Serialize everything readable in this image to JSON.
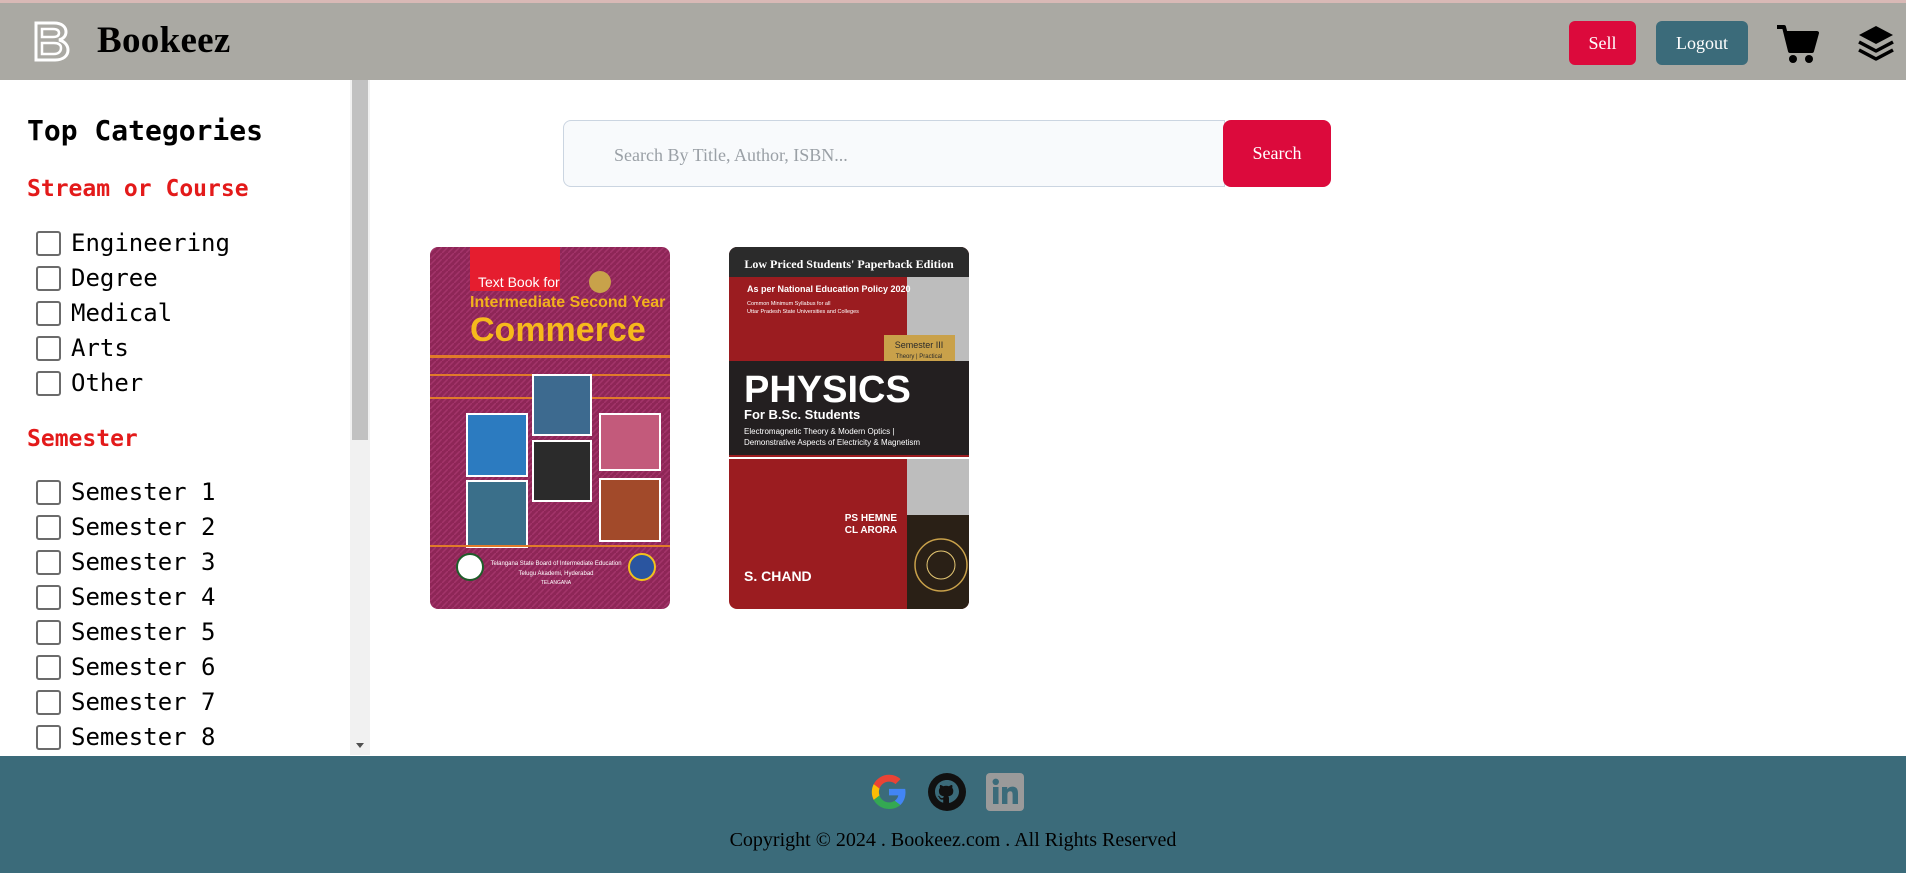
{
  "header": {
    "brand": "Bookeez",
    "sell_label": "Sell",
    "logout_label": "Logout",
    "colors": {
      "bar": "#aaa9a3",
      "sell": "#dc0a3c",
      "logout": "#3b6b7a"
    }
  },
  "sidebar": {
    "title": "Top Categories",
    "groups": [
      {
        "heading": "Stream or Course",
        "items": [
          "Engineering",
          "Degree",
          "Medical",
          "Arts",
          "Other"
        ]
      },
      {
        "heading": "Semester",
        "items": [
          "Semester 1",
          "Semester 2",
          "Semester 3",
          "Semester 4",
          "Semester 5",
          "Semester 6",
          "Semester 7",
          "Semester 8"
        ]
      }
    ]
  },
  "search": {
    "placeholder": "Search By Title, Author, ISBN...",
    "button_label": "Search"
  },
  "books": [
    {
      "cover_top_label": "Text Book for",
      "cover_subtitle": "Intermediate Second Year",
      "cover_title": "Commerce",
      "cover_footer_1": "Telangana State Board of Intermediate Education",
      "cover_footer_2": "Telugu Akademi, Hyderabad",
      "cover_footer_3": "TELANGANA"
    },
    {
      "cover_banner": "Low Priced Students' Paperback Edition",
      "cover_policy": "As per National Education Policy 2020",
      "cover_syllabus_1": "Common Minimum Syllabus for all",
      "cover_syllabus_2": "Uttar Pradesh State Universities and Colleges",
      "cover_semester": "Semester III",
      "cover_semester_sub": "Theory | Practical",
      "cover_title": "PHYSICS",
      "cover_for": "For B.Sc. Students",
      "cover_topics_1": "Electromagnetic Theory & Modern Optics |",
      "cover_topics_2": "Demonstrative Aspects of Electricity & Magnetism",
      "cover_author_1": "PS HEMNE",
      "cover_author_2": "CL ARORA",
      "cover_publisher": "S. CHAND"
    }
  ],
  "footer": {
    "icons": [
      "google-icon",
      "github-icon",
      "linkedin-icon"
    ],
    "copyright": "Copyright © 2024 . Bookeez.com . All Rights Reserved"
  }
}
